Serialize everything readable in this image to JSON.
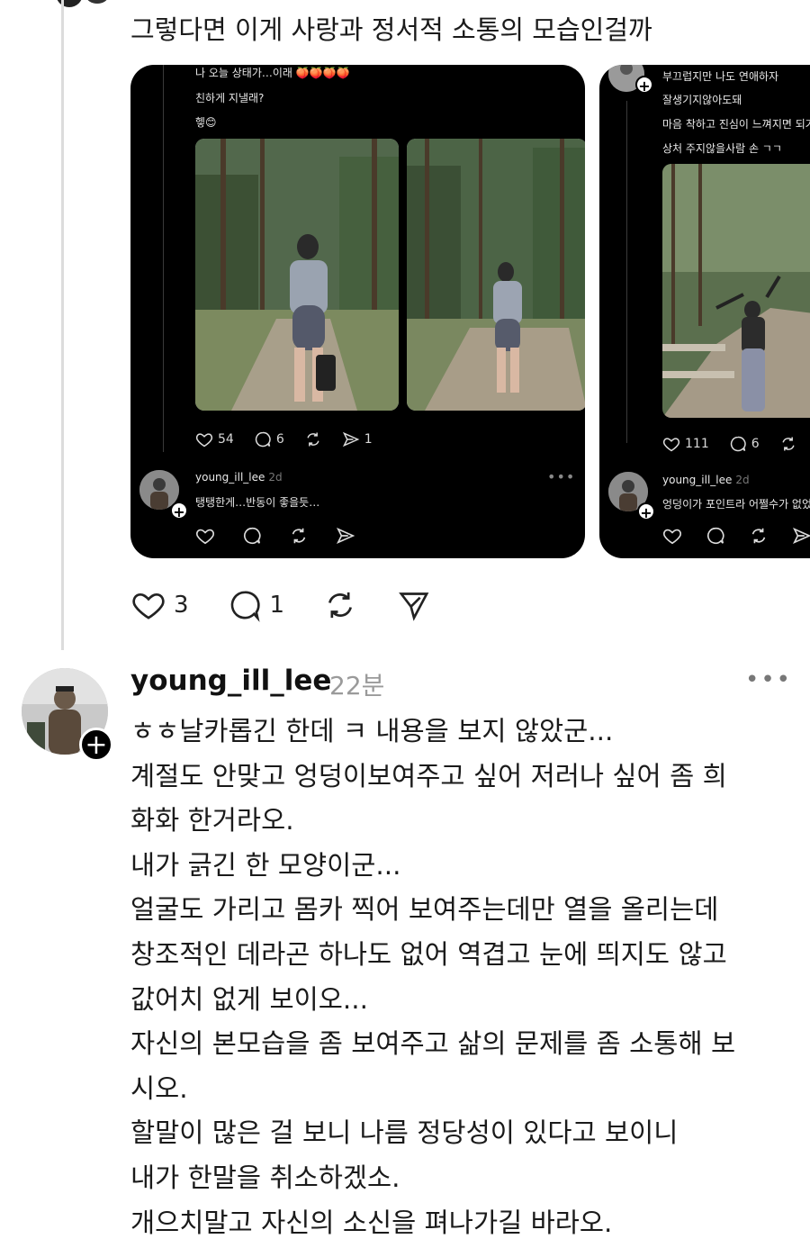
{
  "parent_post": {
    "text": "그렇다면 이게 사랑과 정서적 소통의 모습인걸까",
    "actions": {
      "likes": "3",
      "replies": "1"
    }
  },
  "embedded_left": {
    "lines": [
      "나 오늘 상태가…이래 🍑🍑🍑🍑",
      "친하게 지낼래?",
      "헿😊"
    ],
    "stats": {
      "likes": "54",
      "replies": "6",
      "shares": "1"
    },
    "reply": {
      "username": "young_ill_lee",
      "time": "2d",
      "text": "탱탱한게…반동이 좋을듯…"
    }
  },
  "embedded_right": {
    "lines": [
      "부끄럽지만 나도 연애하자",
      "잘생기지않아도돼",
      "마음 착하고 진심이 느껴지면 되거",
      "상처 주지않을사람 손 ㄱㄱ"
    ],
    "stats": {
      "likes": "111",
      "replies": "6"
    },
    "reply": {
      "username": "young_ill_lee",
      "time": "2d",
      "text": "엉덩이가 포인트라 어쩔수가 없었"
    }
  },
  "comment": {
    "username": "young_ill_lee",
    "time": "22분",
    "lines": [
      "ㅎㅎ날카롭긴 한데 ㅋ 내용을 보지 않았군...",
      "계절도 안맞고 엉덩이보여주고 싶어 저러나 싶어 좀 희",
      "화화 한거라오.",
      "내가 긁긴 한 모양이군...",
      "얼굴도 가리고 몸카 찍어 보여주는데만 열을 올리는데",
      "창조적인 데라곤 하나도 없어 역겹고 눈에 띄지도 않고",
      "값어치 없게 보이오...",
      "자신의 본모습을 좀 보여주고 삶의 문제를 좀 소통해  보",
      "시오.",
      "할말이 많은 걸 보니 나름 정당성이 있다고 보이니",
      "내가 한말을 취소하겠소.",
      "개으치말고 자신의 소신을 펴나가길 바라오."
    ]
  }
}
